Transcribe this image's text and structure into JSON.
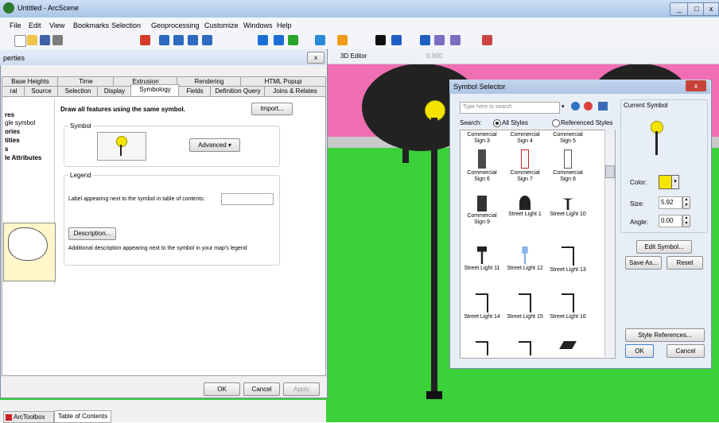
{
  "window": {
    "title": "Untitled - ArcScene"
  },
  "menu": [
    "File",
    "Edit",
    "View",
    "Bookmarks",
    "Selection",
    "Geoprocessing",
    "Customize",
    "Windows",
    "Help"
  ],
  "toolbar3d": {
    "editor_label": "3D Editor",
    "value": "0.000"
  },
  "properties": {
    "title": "perties",
    "tabs_row1": [
      "Base Heights",
      "Time",
      "Extrusion",
      "Rendering",
      "HTML Popup"
    ],
    "tabs_row2": [
      "ral",
      "Source",
      "Selection",
      "Display",
      "Symbology",
      "Fields",
      "Definition Query",
      "Joins & Relates"
    ],
    "show_items": [
      "res",
      "gle symbol",
      "ories",
      "tities",
      "s",
      "le Attributes"
    ],
    "heading": "Draw all features using the same symbol.",
    "import_button": "Import...",
    "symbol_group": "Symbol",
    "advanced_button": "Advanced",
    "legend_group": "Legend",
    "legend_label": "Label appearing next to the symbol in table of contents:",
    "description_button": "Description...",
    "description_text": "Additional description appearing next to the symbol in your map's legend",
    "ok": "OK",
    "cancel": "Cancel",
    "apply": "Apply"
  },
  "bottom_tabs": [
    "ArcToolbox",
    "Table of Contents"
  ],
  "symbol_selector": {
    "title": "Symbol Selector",
    "search_placeholder": "Type here to search",
    "search_label": "Search:",
    "scope_all": "All Styles",
    "scope_ref": "Referenced Styles",
    "symbols": [
      [
        "Commercial Sign 3",
        "Commercial Sign 4",
        "Commercial Sign 5"
      ],
      [
        "Commercial Sign 6",
        "Commercial Sign 7",
        "Commercial Sign 8"
      ],
      [
        "Commercial Sign 9",
        "Street Light 1",
        "Street Light 10"
      ],
      [
        "Street Light 11",
        "Street Light 12",
        "Street Light 13"
      ],
      [
        "Street Light 14",
        "Street Light 15",
        "Street Light 16"
      ],
      [
        "",
        "",
        ""
      ]
    ],
    "current_symbol_label": "Current Symbol",
    "color_label": "Color:",
    "size_label": "Size:",
    "size_value": "5.92",
    "angle_label": "Angle:",
    "angle_value": "0.00",
    "edit_symbol": "Edit Symbol...",
    "save_as": "Save As...",
    "reset": "Reset",
    "style_references": "Style References...",
    "ok": "OK",
    "cancel": "Cancel",
    "color_swatch": "#f5e400"
  }
}
